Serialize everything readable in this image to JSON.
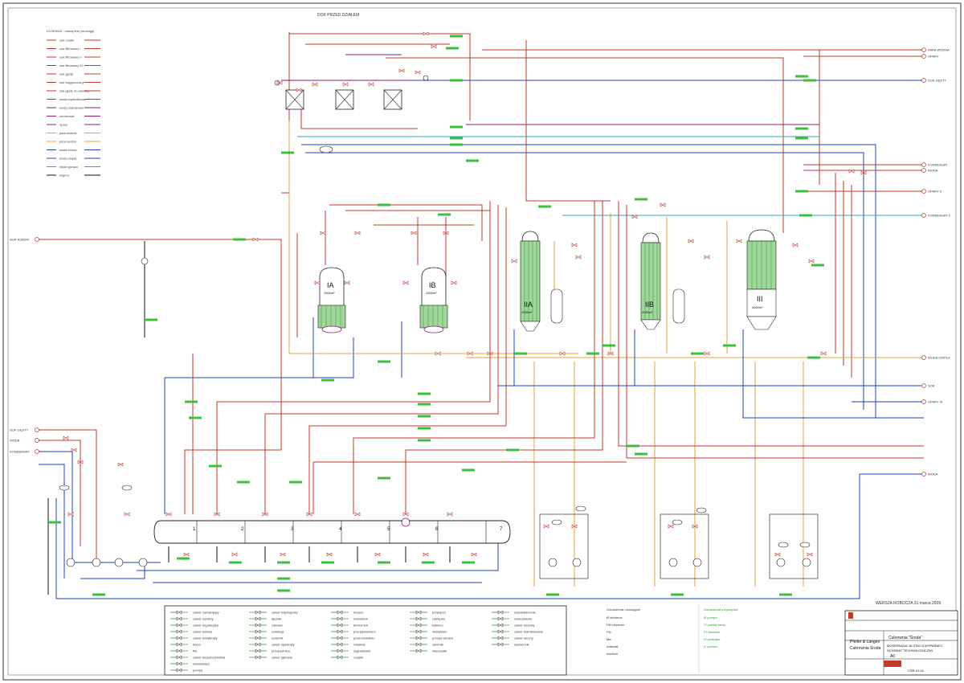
{
  "header": {
    "title": "DOK PRZED DZIAŁEM"
  },
  "legend": {
    "title": "LEGENDA - rodzaj linii (rurociągi)",
    "items": [
      {
        "label": "sok rzadki",
        "color": "#c0392b"
      },
      {
        "label": "sok filtrowany I",
        "color": "#c0392b"
      },
      {
        "label": "sok filtrowany II",
        "color": "#c0392b"
      },
      {
        "label": "sok filtrowany III",
        "color": "#c0392b"
      },
      {
        "label": "sok gęsty",
        "color": "#c0392b"
      },
      {
        "label": "sok zagęszczony",
        "color": "#c0392b"
      },
      {
        "label": "sok gęsty do warnika",
        "color": "#c0392b"
      },
      {
        "label": "woda wysłodkowa",
        "color": "#c0392b"
      },
      {
        "label": "wody poprasowe",
        "color": "#8e1b7a"
      },
      {
        "label": "kondensat",
        "color": "#8e1b7a"
      },
      {
        "label": "opary",
        "color": "#8e1b7a"
      },
      {
        "label": "para świeża",
        "color": "#e6a23c"
      },
      {
        "label": "para wodna",
        "color": "#e6a23c"
      },
      {
        "label": "woda zimna",
        "color": "#1f3fbf"
      },
      {
        "label": "woda ciepła",
        "color": "#1f3fbf"
      },
      {
        "label": "woda gorąca",
        "color": "#2aa9b8"
      },
      {
        "label": "wapno",
        "color": "#111111"
      }
    ]
  },
  "equipment": {
    "evap_IA": {
      "label": "IA",
      "area": "1000m²"
    },
    "evap_IB": {
      "label": "IB",
      "area": "1000m²"
    },
    "evap_IIA": {
      "label": "IIA",
      "area": "2000m²"
    },
    "evap_IIB": {
      "label": "IIB",
      "area": "2000m²"
    },
    "evap_III": {
      "label": "III",
      "area": "4000m²"
    },
    "header_tank_numbers": [
      "1",
      "2",
      "3",
      "4",
      "5",
      "6",
      "7"
    ]
  },
  "inputs_left": [
    "SOK RZADKI",
    "SOK GĘSTY",
    "WODA",
    "KONDENSAT"
  ],
  "outputs_right": [
    "PARA WODNA",
    "OPARY",
    "SOK GĘSTY",
    "KONDENSAT",
    "WODA",
    "OPARY II",
    "KONDENSAT II",
    "WODA CIEPŁA",
    "SOK",
    "OPARY III",
    "WODA"
  ],
  "symbol_legend": {
    "col1": [
      "zawór zamykający",
      "zawór zwrotny",
      "zawór regulacyjny",
      "zawór kulowy",
      "zawór motylkowy",
      "kryza",
      "filtr",
      "zawór bezpieczeństwa",
      "odwadniacz",
      "pompa"
    ],
    "col2": [
      "zawór trójdrogowy",
      "łącznik",
      "zasuwa",
      "redukcja",
      "wziernik",
      "zawór spustowy",
      "przepustnica",
      "zawór iglicowy"
    ],
    "col3": [
      "króciec",
      "manometr",
      "termometr",
      "przepływomierz",
      "poziomowskaz",
      "rotametr",
      "sygnalizator",
      "czujnik"
    ],
    "col4": [
      "przyłącze",
      "zaślepka",
      "kołnierz",
      "wentylator",
      "pompa wirowa",
      "zbiornik",
      "mieszadło"
    ],
    "col5": [
      "odpowietrzenie",
      "odwodnienie",
      "zawór nożowy",
      "zawór mambranowy",
      "zawór ręczny",
      "wymiennik"
    ]
  },
  "notes": {
    "title": "Oznaczenia rurociągów",
    "lines": [
      "Ø średnica",
      "DN ciśnienie",
      "PN",
      "Ma",
      "materiał",
      "medium"
    ],
    "second_title": "Oznaczenia przyrządów",
    "second_lines": [
      "Ø pompa",
      "TI pomiar temp.",
      "PI ciśnienie",
      "FI przepływ",
      "LI poziom"
    ]
  },
  "version": "WERSJA ROBOCZA 31 marca 2009",
  "title_block": {
    "company_1": "Pfeifer & Langen",
    "company_2": "Cukrownia Środa",
    "site": "Cukrownia \"Środa\"",
    "drawing_title_1": "MODERNIZACJA STACJI WYPARNEJ",
    "drawing_title_2": "SCHEMAT TECHNOLOGICZNY",
    "format": "A0",
    "drawing_number": "CSR-01-01"
  }
}
